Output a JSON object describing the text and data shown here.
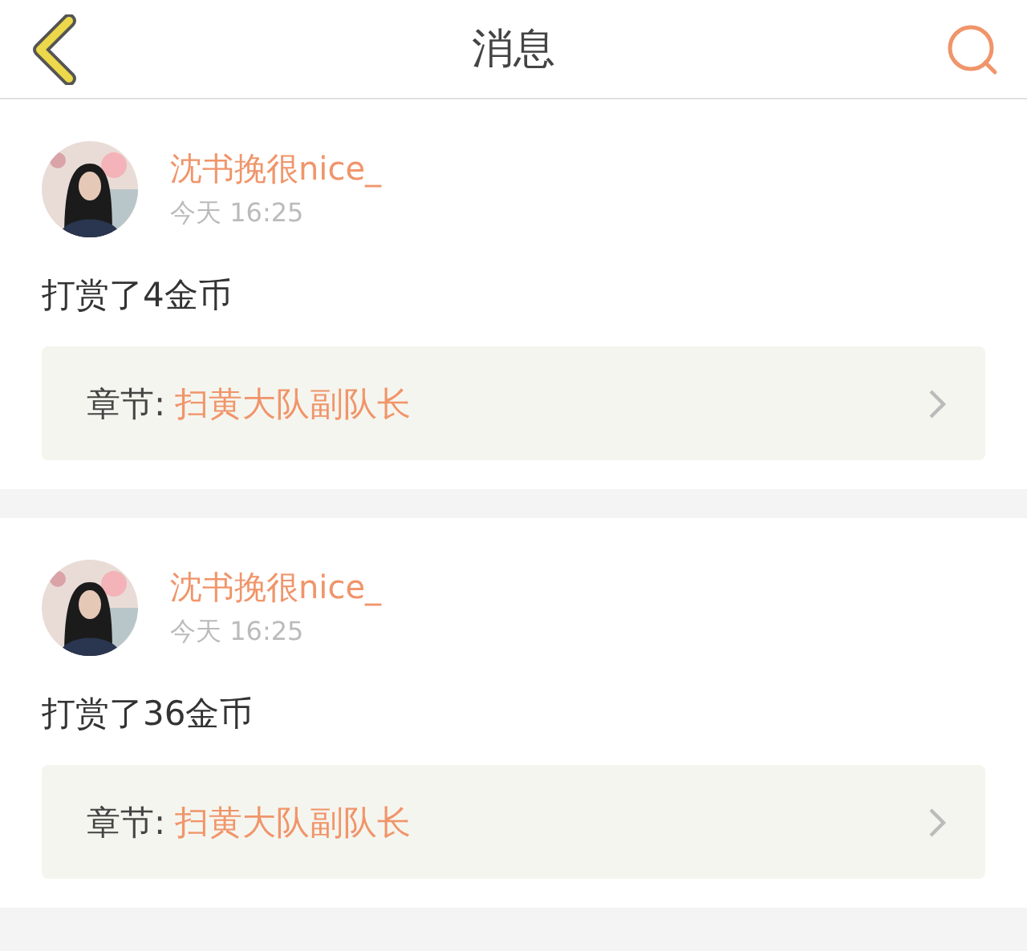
{
  "header": {
    "title": "消息"
  },
  "messages": [
    {
      "user": "沈书挽很nice_",
      "time": "今天 16:25",
      "text": "打赏了4金币",
      "chapter_label": "章节:",
      "chapter": "扫黄大队副队长"
    },
    {
      "user": "沈书挽很nice_",
      "time": "今天 16:25",
      "text": "打赏了36金币",
      "chapter_label": "章节:",
      "chapter": "扫黄大队副队长"
    }
  ]
}
